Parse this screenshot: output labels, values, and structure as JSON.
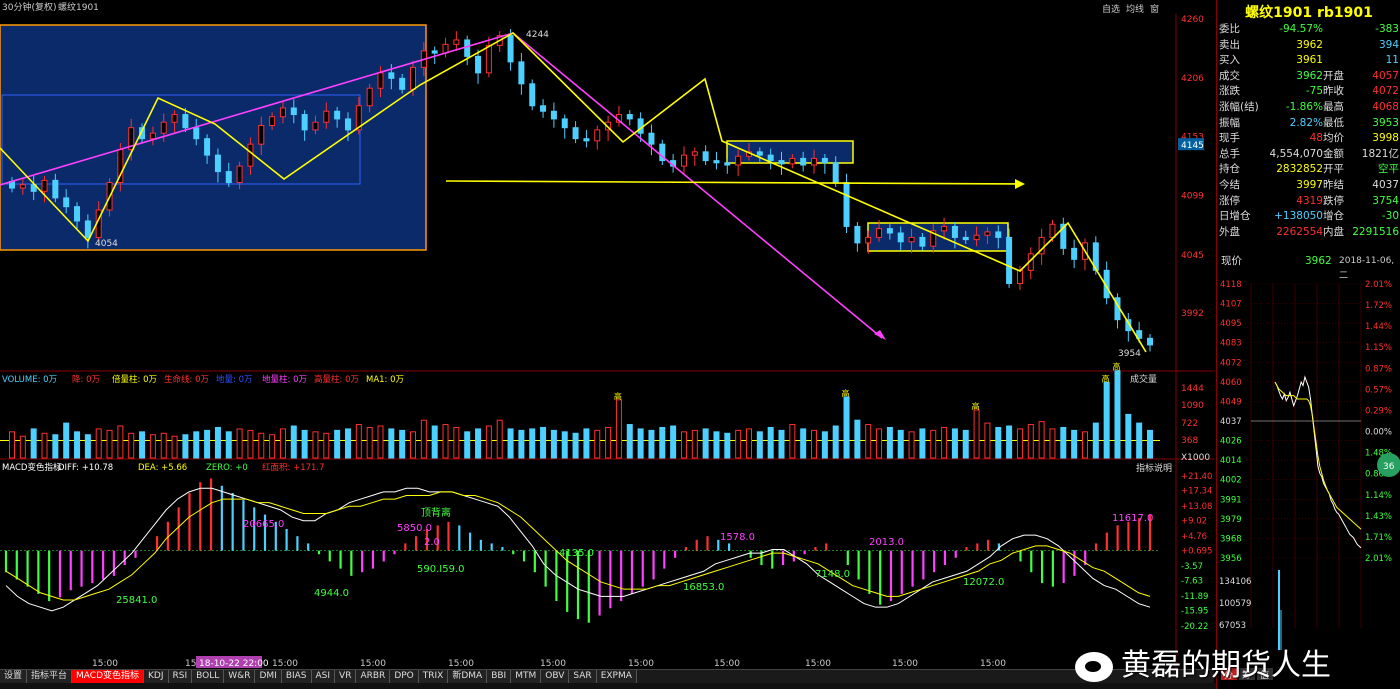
{
  "header": {
    "period_label": "30分钟(复权)",
    "instrument": "螺纹1901",
    "toolbar": [
      "自选",
      "均线",
      "窗"
    ]
  },
  "price_axis": {
    "labels": [
      "4260",
      "4206",
      "4153",
      "4145",
      "4099",
      "4045",
      "3992"
    ]
  },
  "annotations": {
    "high_label": "4244",
    "low_label_1": "4054",
    "low_label_2": "3954"
  },
  "volume_panel": {
    "legend": [
      {
        "text": "VOLUME: 0万",
        "color": "#4dd0ff"
      },
      {
        "text": "降: 0万",
        "color": "#ff3030"
      },
      {
        "text": "倍量柱: 0万",
        "color": "#ffff00"
      },
      {
        "text": "生命线: 0万",
        "color": "#ff3030"
      },
      {
        "text": "地量: 0万",
        "color": "#3050ff"
      },
      {
        "text": "地量柱: 0万",
        "color": "#ff40ff"
      },
      {
        "text": "高量柱: 0万",
        "color": "#ff3030"
      },
      {
        "text": "MA1: 0万",
        "color": "#ffff00"
      }
    ],
    "button": "成交量",
    "axis": [
      "1444",
      "1090",
      "722",
      "368",
      "X1000"
    ],
    "tag": "高"
  },
  "macd_panel": {
    "legend": [
      {
        "text": "MACD变色指标",
        "color": "#ffffff"
      },
      {
        "text": "DIFF: +10.78",
        "color": "#ffffff"
      },
      {
        "text": "DEA: +5.66",
        "color": "#ffff00"
      },
      {
        "text": "ZERO: +0",
        "color": "#40ff40"
      },
      {
        "text": "红面积: +171.7",
        "color": "#ff3030"
      }
    ],
    "button": "指标说明",
    "axis": [
      "+21.40",
      "+17.34",
      "+13.08",
      "+9.02",
      "+4.76",
      "+0.695",
      "-3.57",
      "-7.63",
      "-11.89",
      "-15.95",
      "-20.22"
    ],
    "notes": [
      {
        "text": "25841.0",
        "color": "#40ff40"
      },
      {
        "text": "20665.0",
        "color": "#ff40ff"
      },
      {
        "text": "4944.0",
        "color": "#40ff40"
      },
      {
        "text": "5850.0",
        "color": "#ff40ff"
      },
      {
        "text": "顶背离",
        "color": "#40ff40"
      },
      {
        "text": "2.0",
        "color": "#ff40ff"
      },
      {
        "text": "590.I59.0",
        "color": "#40ff40"
      },
      {
        "text": "4135.0",
        "color": "#40ff40"
      },
      {
        "text": "16853.0",
        "color": "#40ff40"
      },
      {
        "text": "1578.0",
        "color": "#ff40ff"
      },
      {
        "text": "7148.0",
        "color": "#40ff40"
      },
      {
        "text": "2013.0",
        "color": "#ff40ff"
      },
      {
        "text": "12072.0",
        "color": "#40ff40"
      },
      {
        "text": "11617.0",
        "color": "#ff40ff"
      }
    ]
  },
  "time_axis": {
    "labels": [
      "15:00",
      "15:00",
      "18-10-22 22:00",
      "15:00",
      "15:00",
      "15:00",
      "15:00",
      "15:00",
      "15:00",
      "15:00",
      "15:00",
      "15:00"
    ]
  },
  "tabs": [
    "设置",
    "指标平台",
    "MACD变色指标",
    "KDJ",
    "RSI",
    "BOLL",
    "W&R",
    "DMI",
    "BIAS",
    "ASI",
    "VR",
    "ARBR",
    "DPO",
    "TRIX",
    "新DMA",
    "BBI",
    "MTM",
    "OBV",
    "SAR",
    "EXPMA"
  ],
  "right_panel": {
    "title": "螺纹1901 rb1901",
    "quotes": [
      {
        "l1": "委比",
        "v1": "-94.57%",
        "c1": "#40ff40",
        "l2": "",
        "v2": "-383",
        "c2": "#40ff40"
      },
      {
        "l1": "卖出",
        "v1": "3962",
        "c1": "#ffff00",
        "l2": "",
        "v2": "394",
        "c2": "#4dd0ff"
      },
      {
        "l1": "买入",
        "v1": "3961",
        "c1": "#ffff00",
        "l2": "",
        "v2": "11",
        "c2": "#4dd0ff"
      },
      {
        "l1": "成交",
        "v1": "3962",
        "c1": "#40ff40",
        "l2": "开盘",
        "v2": "4057",
        "c2": "#ff3030"
      },
      {
        "l1": "涨跌",
        "v1": "-75",
        "c1": "#40ff40",
        "l2": "昨收",
        "v2": "4072",
        "c2": "#ff3030"
      },
      {
        "l1": "涨幅(结)",
        "v1": "-1.86%",
        "c1": "#40ff40",
        "l2": "最高",
        "v2": "4068",
        "c2": "#ff3030"
      },
      {
        "l1": "振幅",
        "v1": "2.82%",
        "c1": "#4dd0ff",
        "l2": "最低",
        "v2": "3953",
        "c2": "#40ff40"
      },
      {
        "l1": "现手",
        "v1": "48",
        "c1": "#ff3030",
        "l2": "均价",
        "v2": "3998",
        "c2": "#ffff00"
      },
      {
        "l1": "总手",
        "v1": "4,554,070",
        "c1": "#dddddd",
        "l2": "金额",
        "v2": "1821亿",
        "c2": "#dddddd"
      },
      {
        "l1": "持仓",
        "v1": "2832852",
        "c1": "#ffff00",
        "l2": "开平",
        "v2": "空平",
        "c2": "#40ff40"
      },
      {
        "l1": "今结",
        "v1": "3997",
        "c1": "#ffff00",
        "l2": "昨结",
        "v2": "4037",
        "c2": "#dddddd"
      },
      {
        "l1": "涨停",
        "v1": "4319",
        "c1": "#ff3030",
        "l2": "跌停",
        "v2": "3754",
        "c2": "#40ff40"
      },
      {
        "l1": "日增仓",
        "v1": "+138050",
        "c1": "#4dd0ff",
        "l2": "增仓",
        "v2": "-30",
        "c2": "#40ff40"
      },
      {
        "l1": "外盘",
        "v1": "2262554",
        "c1": "#ff3030",
        "l2": "内盘",
        "v2": "2291516",
        "c2": "#40ff40"
      }
    ],
    "current_label": "现价",
    "current_value": "3962",
    "date": "2018-11-06,二",
    "mini_price_axis": [
      "4118",
      "4107",
      "4095",
      "4083",
      "4072",
      "4060",
      "4049",
      "4037",
      "4026",
      "4014",
      "4002",
      "3991",
      "3979",
      "3968",
      "3956"
    ],
    "mini_pct_axis": [
      "2.01%",
      "1.72%",
      "1.44%",
      "1.15%",
      "0.87%",
      "0.57%",
      "0.29%",
      "0.00%",
      "1.48%",
      "0.86%",
      "1.14%",
      "1.43%",
      "1.71%",
      "2.01%"
    ],
    "mini_volume_axis": [
      "134106",
      "100579",
      "67053"
    ],
    "mini_badge": "36",
    "mini_tabs": [
      "分",
      "筹",
      "值"
    ]
  },
  "watermark": "黄磊的期货人生",
  "colors": {
    "up": "#ff3030",
    "down": "#4dd0ff",
    "ma": "#ffff00",
    "trend": "#ff40ff",
    "box_fill": "#0a2a6a",
    "box_border": "#ff9900"
  },
  "chart_data": {
    "type": "candlestick",
    "title": "",
    "y_range": [
      3954,
      4260
    ],
    "price_ticks": [
      4260,
      4206,
      4153,
      4099,
      4045,
      3992
    ],
    "current_price_marker": 4145,
    "annotated_high": 4244,
    "annotated_lows": [
      4054,
      3954
    ],
    "zigzag_points": [
      4120,
      4054,
      4180,
      4110,
      4170,
      4104,
      4244,
      4150,
      4210,
      4140,
      4012,
      4075,
      3954
    ],
    "close_path": [
      4105,
      4108,
      4102,
      4112,
      4096,
      4088,
      4075,
      4060,
      4085,
      4110,
      4140,
      4160,
      4150,
      4155,
      4165,
      4172,
      4160,
      4150,
      4135,
      4120,
      4110,
      4125,
      4145,
      4162,
      4170,
      4178,
      4172,
      4158,
      4165,
      4175,
      4168,
      4158,
      4180,
      4196,
      4210,
      4205,
      4195,
      4215,
      4230,
      4228,
      4236,
      4240,
      4225,
      4210,
      4235,
      4244,
      4220,
      4200,
      4180,
      4175,
      4168,
      4160,
      4150,
      4148,
      4158,
      4165,
      4172,
      4168,
      4155,
      4145,
      4130,
      4125,
      4135,
      4138,
      4130,
      4128,
      4126,
      4134,
      4138,
      4135,
      4130,
      4127,
      4132,
      4126,
      4132,
      4128,
      4110,
      4070,
      4055,
      4060,
      4068,
      4064,
      4056,
      4060,
      4052,
      4066,
      4070,
      4060,
      4058,
      4062,
      4065,
      4060,
      4018,
      4030,
      4045,
      4060,
      4072,
      4050,
      4040,
      4055,
      4030,
      4005,
      3985,
      3975,
      3968,
      3962
    ],
    "volume": [
      180,
      150,
      200,
      170,
      160,
      240,
      180,
      160,
      200,
      190,
      220,
      170,
      180,
      160,
      170,
      150,
      160,
      180,
      190,
      210,
      180,
      200,
      190,
      170,
      160,
      200,
      220,
      190,
      180,
      170,
      190,
      200,
      230,
      210,
      220,
      200,
      190,
      180,
      260,
      220,
      230,
      210,
      180,
      200,
      220,
      260,
      200,
      190,
      200,
      210,
      190,
      180,
      170,
      200,
      190,
      210,
      400,
      230,
      200,
      190,
      210,
      220,
      180,
      190,
      200,
      180,
      170,
      190,
      200,
      180,
      210,
      190,
      230,
      200,
      190,
      180,
      220,
      420,
      260,
      230,
      200,
      210,
      190,
      180,
      200,
      190,
      210,
      200,
      190,
      330,
      240,
      210,
      220,
      200,
      230,
      250,
      200,
      210,
      190,
      180,
      240,
      520,
      600,
      300,
      240,
      190
    ],
    "volume_ticks": [
      1444,
      1090,
      722,
      368
    ],
    "macd_hist": [
      -6,
      -8,
      -10,
      -12,
      -14,
      -13,
      -11,
      -10,
      -9,
      -8,
      -7,
      -4,
      -2,
      0,
      4,
      8,
      12,
      16,
      19,
      20,
      18,
      16,
      14,
      12,
      10,
      8,
      6,
      4,
      2,
      -1,
      -3,
      -5,
      -7,
      -6,
      -5,
      -3,
      -1,
      2,
      4,
      6,
      7,
      8,
      7,
      5,
      3,
      2,
      1,
      -1,
      -3,
      -6,
      -10,
      -14,
      -17,
      -19,
      -20,
      -18,
      -16,
      -14,
      -12,
      -10,
      -8,
      -5,
      -2,
      1,
      3,
      4,
      3,
      2,
      0,
      -2,
      -4,
      -5,
      -4,
      -3,
      -1,
      1,
      2,
      0,
      -4,
      -8,
      -12,
      -15,
      -14,
      -12,
      -10,
      -8,
      -6,
      -4,
      -2,
      1,
      2,
      3,
      2,
      0,
      -3,
      -6,
      -9,
      -10,
      -9,
      -7,
      -4,
      2,
      5,
      7,
      8,
      9,
      10
    ],
    "diff_line": [
      -9,
      -12,
      -14,
      -15,
      -16,
      -15,
      -13,
      -11,
      -9,
      -6,
      -3,
      0,
      4,
      8,
      12,
      15,
      17,
      18,
      18,
      17,
      16,
      15,
      14,
      13,
      12,
      10,
      9,
      9,
      11,
      12,
      14,
      15,
      16,
      17,
      17,
      18,
      18,
      17,
      17,
      17,
      16,
      15,
      14,
      13,
      10,
      6,
      2,
      -3,
      -6,
      -8,
      -10,
      -11,
      -12,
      -12,
      -12,
      -11,
      -10,
      -9,
      -8,
      -7,
      -6,
      -5,
      -3,
      -2,
      -1,
      0,
      0,
      1,
      1,
      -1,
      -3,
      -6,
      -8,
      -10,
      -12,
      -14,
      -15,
      -15,
      -14,
      -12,
      -10,
      -8,
      -7,
      -6,
      -5,
      -3,
      -1,
      2,
      4,
      5,
      5,
      4,
      2,
      -1,
      -4,
      -7,
      -9,
      -10,
      -12,
      -14,
      -15
    ],
    "dea_line": [
      -5,
      -7,
      -9,
      -11,
      -12,
      -13,
      -13,
      -12,
      -11,
      -10,
      -8,
      -6,
      -3,
      0,
      4,
      7,
      10,
      12,
      14,
      15,
      15,
      15,
      14,
      14,
      13,
      12,
      11,
      11,
      11,
      12,
      13,
      13,
      14,
      15,
      15,
      16,
      16,
      16,
      17,
      17,
      16,
      16,
      15,
      14,
      12,
      10,
      7,
      4,
      1,
      -2,
      -4,
      -6,
      -8,
      -9,
      -10,
      -10,
      -10,
      -9,
      -9,
      -8,
      -7,
      -6,
      -5,
      -4,
      -3,
      -2,
      -1,
      0,
      0,
      -1,
      -2,
      -3,
      -5,
      -7,
      -9,
      -10,
      -11,
      -12,
      -12,
      -11,
      -10,
      -9,
      -8,
      -7,
      -6,
      -5,
      -3,
      -2,
      0,
      1,
      2,
      2,
      1,
      0,
      -2,
      -4,
      -5,
      -7,
      -9,
      -11,
      -12
    ],
    "macd_ticks": [
      21.4,
      17.34,
      13.08,
      9.02,
      4.76,
      0.695,
      -3.57,
      -7.63,
      -11.89,
      -15.95,
      -20.22
    ],
    "intraday_price": [
      4060,
      4058,
      4055,
      4052,
      4050,
      4053,
      4049,
      4051,
      4054,
      4050,
      4046,
      4049,
      4052,
      4056,
      4060,
      4058,
      4063,
      4060,
      4057,
      4050,
      4040,
      4030,
      4020,
      4010,
      4006,
      4004,
      4000,
      3998,
      3996,
      3994,
      3990,
      3988,
      3985,
      3983,
      3982,
      3980,
      3978,
      3976,
      3974,
      3972,
      3970,
      3969,
      3968,
      3966,
      3964,
      3963,
      3962
    ],
    "intraday_avg": [
      4060,
      4058,
      4056,
      4055,
      4054,
      4053,
      4052,
      4052,
      4052,
      4052,
      4052,
      4051,
      4050,
      4050,
      4050,
      4050,
      4050,
      4050,
      4049,
      4046,
      4040,
      4032,
      4024,
      4016,
      4010,
      4006,
      4002,
      3999,
      3996,
      3994,
      3992,
      3990,
      3988,
      3986,
      3985,
      3984,
      3983,
      3982,
      3981,
      3980,
      3979,
      3978,
      3977,
      3976,
      3975,
      3974,
      3973
    ]
  }
}
